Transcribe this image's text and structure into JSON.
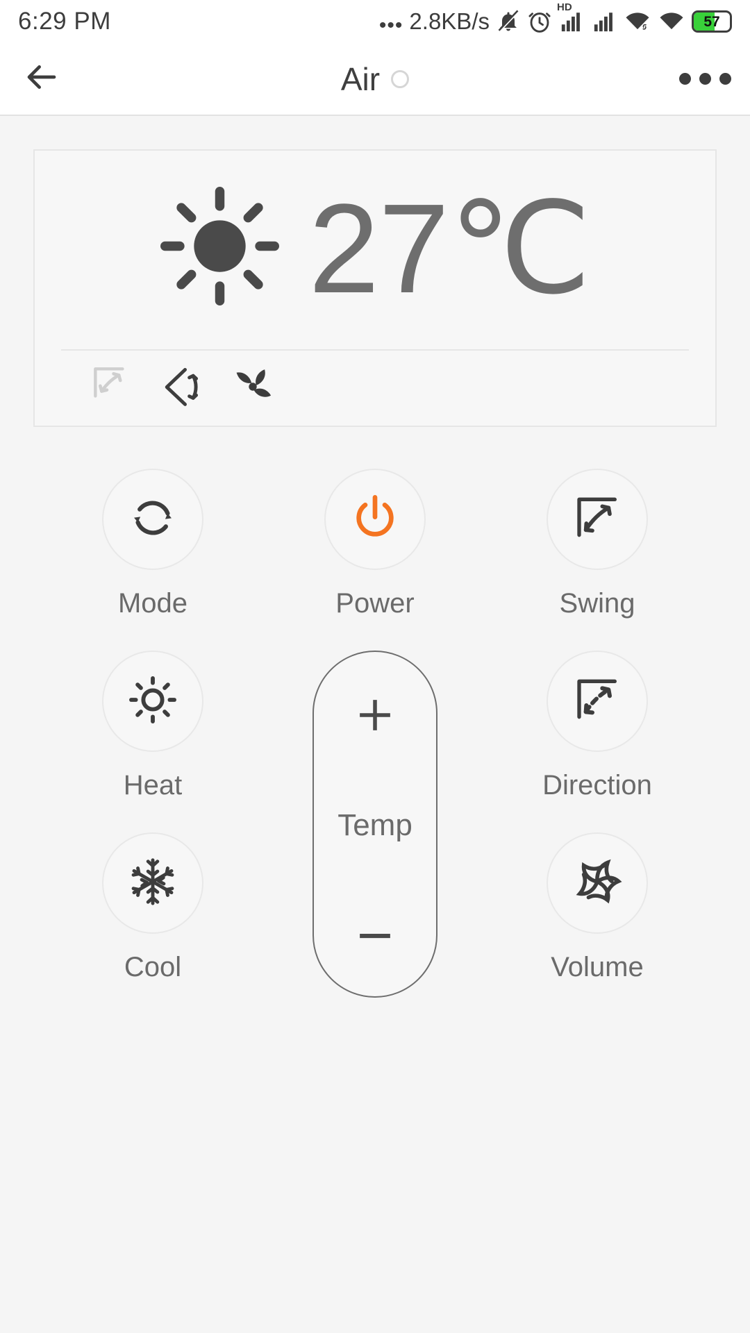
{
  "status_bar": {
    "time": "6:29 PM",
    "dots": "•••",
    "network_speed": "2.8KB/s",
    "icons": [
      "mute-icon",
      "alarm-icon",
      "hd-signal-icon",
      "signal-icon",
      "wifi-link-icon",
      "wifi-icon"
    ],
    "hd_label": "HD",
    "battery_percent": "57",
    "battery_level": 57
  },
  "app_bar": {
    "back_icon": "back-arrow-icon",
    "title": "Air",
    "status_dot": "connection-status-dot",
    "more_icon": "overflow-menu-icon"
  },
  "display_card": {
    "mode_icon": "sun-filled-icon",
    "temperature": "27℃",
    "status_icons": [
      {
        "name": "swing-status-icon",
        "active": false
      },
      {
        "name": "direction-status-icon",
        "active": true
      },
      {
        "name": "fan-status-icon",
        "active": true
      }
    ]
  },
  "controls": [
    {
      "id": "mode",
      "label": "Mode",
      "icon": "mode-refresh-icon"
    },
    {
      "id": "power",
      "label": "Power",
      "icon": "power-icon",
      "accent": "#f47421"
    },
    {
      "id": "swing",
      "label": "Swing",
      "icon": "swing-icon"
    },
    {
      "id": "heat",
      "label": "Heat",
      "icon": "heat-sun-icon"
    },
    {
      "id": "direction",
      "label": "Direction",
      "icon": "direction-icon"
    },
    {
      "id": "cool",
      "label": "Cool",
      "icon": "snowflake-icon"
    },
    {
      "id": "volume",
      "label": "Volume",
      "icon": "volume-pinwheel-icon"
    }
  ],
  "temp_stepper": {
    "plus_label": "+",
    "label": "Temp",
    "minus_label": "−"
  },
  "colors": {
    "background": "#f5f5f5",
    "card_background": "#f7f7f7",
    "border": "#e6e6e6",
    "text": "#6a6a6a",
    "temp_text": "#6e6e6e",
    "icon_dark": "#3d3d3d",
    "icon_muted": "#cfcfcf",
    "accent_orange": "#f47421",
    "battery_green": "#39d13a"
  }
}
